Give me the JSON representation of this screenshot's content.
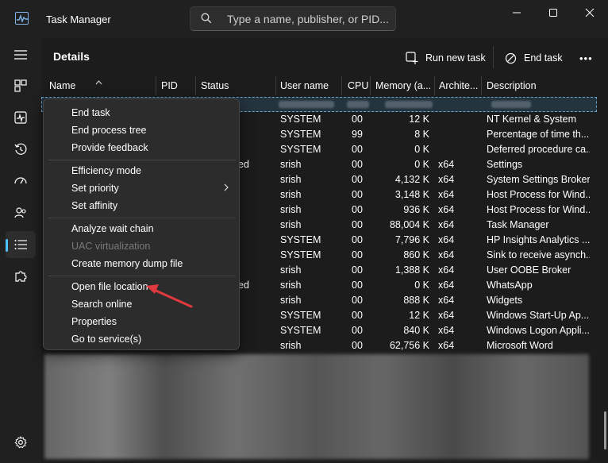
{
  "window": {
    "title": "Task Manager",
    "search_placeholder": "Type a name, publisher, or PID..."
  },
  "nav": {
    "items": [
      "hamburger-menu",
      "processes",
      "performance",
      "app-history",
      "startup-apps",
      "users",
      "details",
      "services"
    ],
    "active": "details",
    "settings": "settings"
  },
  "page": {
    "title": "Details",
    "run_new_task": "Run new task",
    "end_task": "End task",
    "more": "•••"
  },
  "table": {
    "columns": [
      "Name",
      "PID",
      "Status",
      "User name",
      "CPU",
      "Memory (a...",
      "Archite...",
      "Description"
    ],
    "rows": [
      {
        "user": "",
        "cpu": "",
        "mem": "",
        "arch": "",
        "desc": ""
      },
      {
        "user": "SYSTEM",
        "cpu": "00",
        "mem": "12 K",
        "arch": "",
        "desc": "NT Kernel & System"
      },
      {
        "user": "SYSTEM",
        "cpu": "99",
        "mem": "8 K",
        "arch": "",
        "desc": "Percentage of time th..."
      },
      {
        "user": "SYSTEM",
        "cpu": "00",
        "mem": "0 K",
        "arch": "",
        "desc": "Deferred procedure ca..."
      },
      {
        "user": "srish",
        "cpu": "00",
        "mem": "0 K",
        "arch": "x64",
        "desc": "Settings",
        "status": "ed"
      },
      {
        "user": "srish",
        "cpu": "00",
        "mem": "4,132 K",
        "arch": "x64",
        "desc": "System Settings Broker"
      },
      {
        "user": "srish",
        "cpu": "00",
        "mem": "3,148 K",
        "arch": "x64",
        "desc": "Host Process for Wind..."
      },
      {
        "user": "srish",
        "cpu": "00",
        "mem": "936 K",
        "arch": "x64",
        "desc": "Host Process for Wind..."
      },
      {
        "user": "srish",
        "cpu": "00",
        "mem": "88,004 K",
        "arch": "x64",
        "desc": "Task Manager"
      },
      {
        "user": "SYSTEM",
        "cpu": "00",
        "mem": "7,796 K",
        "arch": "x64",
        "desc": "HP Insights Analytics ..."
      },
      {
        "user": "SYSTEM",
        "cpu": "00",
        "mem": "860 K",
        "arch": "x64",
        "desc": "Sink to receive asynch..."
      },
      {
        "user": "srish",
        "cpu": "00",
        "mem": "1,388 K",
        "arch": "x64",
        "desc": "User OOBE Broker"
      },
      {
        "user": "srish",
        "cpu": "00",
        "mem": "0 K",
        "arch": "x64",
        "desc": "WhatsApp",
        "status": "ed"
      },
      {
        "user": "srish",
        "cpu": "00",
        "mem": "888 K",
        "arch": "x64",
        "desc": "Widgets"
      },
      {
        "user": "SYSTEM",
        "cpu": "00",
        "mem": "12 K",
        "arch": "x64",
        "desc": "Windows Start-Up Ap..."
      },
      {
        "user": "SYSTEM",
        "cpu": "00",
        "mem": "840 K",
        "arch": "x64",
        "desc": "Windows Logon Appli..."
      },
      {
        "user": "srish",
        "cpu": "00",
        "mem": "62,756 K",
        "arch": "x64",
        "desc": "Microsoft Word"
      }
    ]
  },
  "context_menu": {
    "groups": [
      [
        "End task",
        "End process tree",
        "Provide feedback"
      ],
      [
        "Efficiency mode",
        "Set priority",
        "Set affinity"
      ],
      [
        "Analyze wait chain",
        "UAC virtualization",
        "Create memory dump file"
      ],
      [
        "Open file location",
        "Search online",
        "Properties",
        "Go to service(s)"
      ]
    ],
    "disabled": [
      "UAC virtualization"
    ],
    "submenu": [
      "Set priority"
    ],
    "highlighted_by_arrow": "Open file location"
  },
  "colors": {
    "accent": "#4cc2ff",
    "arrow": "#e0393e",
    "background": "#1c1c1c",
    "menu": "#2c2c2c"
  }
}
